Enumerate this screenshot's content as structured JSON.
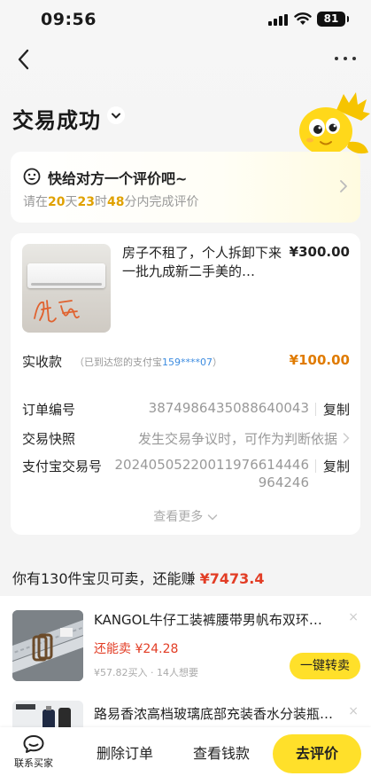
{
  "status_bar": {
    "time": "09:56",
    "battery": "81"
  },
  "header": {
    "title": "交易成功"
  },
  "rating_banner": {
    "title": "快给对方一个评价吧~",
    "prefix": "请在",
    "days": "20",
    "days_unit": "天",
    "hours": "23",
    "hours_unit": "时",
    "minutes": "48",
    "suffix": "分内完成评价"
  },
  "order": {
    "product_name": "房子不租了，个人拆卸下来一批九成新二手美的…",
    "price": "¥300.00",
    "thumbnail_text": "便宜",
    "received_label": "实收款",
    "received_note_prefix": "（已到达您的支付宝",
    "received_account": "159****07",
    "received_note_suffix": "）",
    "received_amount": "¥100.00",
    "rows": [
      {
        "label": "订单编号",
        "value": "3874986435088640043",
        "action": "复制"
      },
      {
        "label": "交易快照",
        "value": "发生交易争议时，可作为判断依据"
      },
      {
        "label": "支付宝交易号",
        "value_line1": "20240505220011976614446",
        "value_line2": "964246",
        "action": "复制"
      }
    ],
    "see_more": "查看更多"
  },
  "resell": {
    "prefix": "你有130件宝贝可卖，还能赚",
    "amount": "¥7473.4",
    "items": [
      {
        "title": "KANGOL牛仔工装裤腰带男帆布双环扣简…",
        "can_sell_label": "还能卖",
        "can_sell_price": "¥24.28",
        "bought": "¥57.82买入",
        "dot": "·",
        "wants": "14人想要",
        "button": "一键转卖",
        "close": "×"
      },
      {
        "title": "路易香浓高档玻璃底部充装香水分装瓶旅…",
        "close": "×"
      }
    ]
  },
  "bottom_bar": {
    "contact": "联系买家",
    "delete_order": "删除订单",
    "view_wallet": "查看钱款",
    "rate": "去评价"
  },
  "colors": {
    "accent_yellow": "#ffe02a",
    "price_red": "#e23d25",
    "received_orange": "#e07b00",
    "link_blue": "#3b8be0",
    "countdown_gold": "#e0a100"
  }
}
